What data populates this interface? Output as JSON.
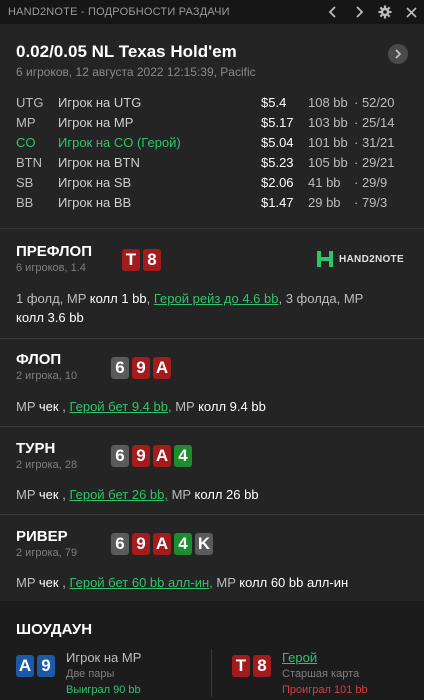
{
  "window": {
    "title": "HAND2NOTE - ПОДРОБНОСТИ РАЗДАЧИ",
    "icons": [
      "chevron-left-icon",
      "chevron-right-icon",
      "gear-icon",
      "close-icon"
    ]
  },
  "hand": {
    "title": "0.02/0.05 NL Texas Hold'em",
    "subtitle": "6 игроков, 12 августа 2022 12:15:39, Pacific"
  },
  "players": [
    {
      "pos": "UTG",
      "name": "Игрок на UTG",
      "stack": "$5.4",
      "bb": "108 bb",
      "stats": "· 52/20",
      "hero": false
    },
    {
      "pos": "MP",
      "name": "Игрок на MP",
      "stack": "$5.17",
      "bb": "103 bb",
      "stats": "· 25/14",
      "hero": false
    },
    {
      "pos": "CO",
      "name": "Игрок на CO (Герой)",
      "stack": "$5.04",
      "bb": "101 bb",
      "stats": "· 31/21",
      "hero": true
    },
    {
      "pos": "BTN",
      "name": "Игрок на BTN",
      "stack": "$5.23",
      "bb": "105 bb",
      "stats": "· 29/21",
      "hero": false
    },
    {
      "pos": "SB",
      "name": "Игрок на SB",
      "stack": "$2.06",
      "bb": "41 bb",
      "stats": "· 29/9",
      "hero": false
    },
    {
      "pos": "BB",
      "name": "Игрок на BB",
      "stack": "$1.47",
      "bb": "29 bb",
      "stats": "· 79/3",
      "hero": false
    }
  ],
  "logo": {
    "text": "HAND2NOTE"
  },
  "streets": {
    "preflop": {
      "title": "ПРЕФЛОП",
      "sub": "6 игроков, 1.4",
      "cards": [
        {
          "r": "T",
          "c": "red"
        },
        {
          "r": "8",
          "c": "red"
        }
      ],
      "line1_a": "1 фолд, MP ",
      "line1_b": "колл 1 bb",
      "line1_c": ", ",
      "line1_hero": "Герой рейз до 4.6 bb",
      "line1_d": ", 3 фолда, MP",
      "line2": "колл 3.6 bb"
    },
    "flop": {
      "title": "ФЛОП",
      "sub": "2 игрока, 10",
      "cards": [
        {
          "r": "6",
          "c": "grey"
        },
        {
          "r": "9",
          "c": "red"
        },
        {
          "r": "A",
          "c": "red"
        }
      ],
      "a1": "MP ",
      "a1v": "чек",
      "sep": " , ",
      "hero": "Герой бет 9.4 bb,",
      "a2": " MP ",
      "a2v": "колл 9.4 bb"
    },
    "turn": {
      "title": "ТУРН",
      "sub": "2 игрока, 28",
      "cards": [
        {
          "r": "6",
          "c": "grey"
        },
        {
          "r": "9",
          "c": "red"
        },
        {
          "r": "A",
          "c": "red"
        },
        {
          "r": "4",
          "c": "green"
        }
      ],
      "a1": "MP ",
      "a1v": "чек",
      "sep": " , ",
      "hero": "Герой бет 26 bb,",
      "a2": " MP ",
      "a2v": "колл 26 bb"
    },
    "river": {
      "title": "РИВЕР",
      "sub": "2 игрока, 79",
      "cards": [
        {
          "r": "6",
          "c": "grey"
        },
        {
          "r": "9",
          "c": "red"
        },
        {
          "r": "A",
          "c": "red"
        },
        {
          "r": "4",
          "c": "green"
        },
        {
          "r": "K",
          "c": "grey"
        }
      ],
      "a1": "MP ",
      "a1v": "чек",
      "sep": " , ",
      "hero": "Герой бет 60 bb алл-ин,",
      "a2": " MP ",
      "a2v": "колл 60 bb алл-ин"
    }
  },
  "showdown": {
    "title": "ШОУДАУН",
    "left": {
      "name": "Игрок на MP",
      "desc": "Две пары",
      "result": "Выиграл 90 bb",
      "result_color": "#2ec56a",
      "cards": [
        {
          "r": "A",
          "c": "blue"
        },
        {
          "r": "9",
          "c": "blue"
        }
      ]
    },
    "right": {
      "name": "Герой",
      "desc": "Старшая карта",
      "result": "Проиграл 101 bb",
      "result_color": "#e23a3a",
      "cards": [
        {
          "r": "T",
          "c": "red"
        },
        {
          "r": "8",
          "c": "red"
        }
      ]
    }
  },
  "colors": {
    "hero": "#2ec56a",
    "card_red": "#a31b1b",
    "card_grey": "#5a5a5a",
    "card_green": "#1c8c2d",
    "card_blue": "#1a5aa6"
  }
}
